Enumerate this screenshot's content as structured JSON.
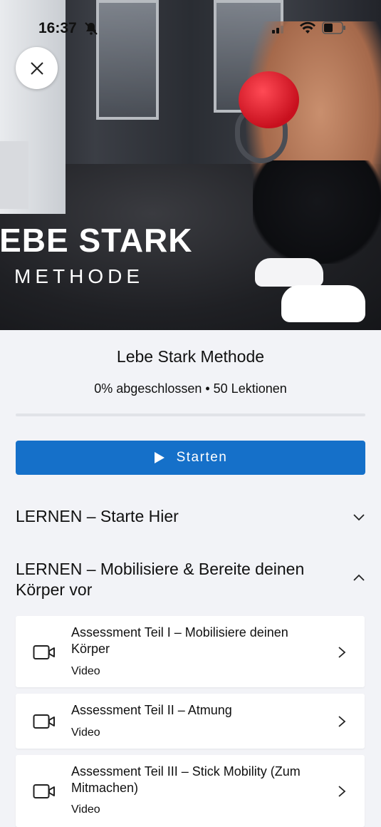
{
  "status_bar": {
    "time": "16:37"
  },
  "hero": {
    "title_line1": "LEBE STARK",
    "title_line2": "METHODE"
  },
  "course": {
    "title": "Lebe Stark Methode",
    "progress_text": "0% abgeschlossen • 50 Lektionen",
    "progress_fraction": 0
  },
  "actions": {
    "start_label": "Starten"
  },
  "sections": [
    {
      "title": "LERNEN – Starte Hier",
      "expanded": false
    },
    {
      "title": "LERNEN – Mobilisiere & Bereite deinen Körper vor",
      "expanded": true
    }
  ],
  "lessons": [
    {
      "title": "Assessment Teil I – Mobilisiere deinen Körper",
      "type": "Video",
      "icon": "video-camera-icon"
    },
    {
      "title": "Assessment Teil II – Atmung",
      "type": "Video",
      "icon": "video-camera-icon"
    },
    {
      "title": "Assessment Teil III – Stick Mobility (Zum Mitmachen)",
      "type": "Video",
      "icon": "video-camera-icon"
    }
  ],
  "colors": {
    "accent": "#1570c9",
    "background": "#f2f3f7",
    "card": "#ffffff"
  }
}
